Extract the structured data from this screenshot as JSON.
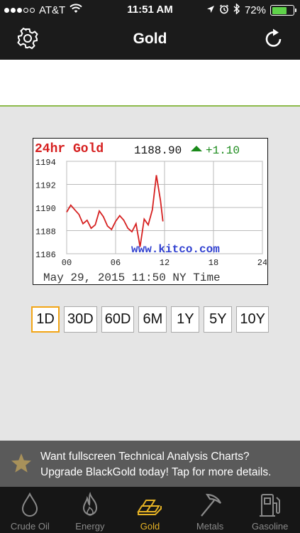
{
  "status_bar": {
    "carrier": "AT&T",
    "time": "11:51 AM",
    "battery_text": "72%",
    "battery_level": 0.72,
    "signal_bars_filled": 3,
    "signal_bars_total": 5
  },
  "nav": {
    "title": "Gold",
    "left_icon": "gear-icon",
    "right_icon": "refresh-icon"
  },
  "chart_image": {
    "title": "24hr Gold",
    "price": "1188.90",
    "change": "+1.10",
    "watermark": "www.kitco.com",
    "timestamp": "May 29, 2015 11:50 NY Time",
    "colors": {
      "title": "#d62020",
      "change": "#1a8a1a",
      "line": "#d62020",
      "watermark": "#3040d0"
    }
  },
  "chart_data": {
    "type": "line",
    "title": "24hr Gold",
    "xlabel": "",
    "ylabel": "",
    "xlim": [
      0,
      24
    ],
    "ylim": [
      1186,
      1194
    ],
    "x_ticks": [
      "00",
      "06",
      "12",
      "18",
      "24"
    ],
    "y_ticks": [
      "1186",
      "1188",
      "1190",
      "1192",
      "1194"
    ],
    "grid": true,
    "series": [
      {
        "x": [
          0,
          0.5,
          1,
          1.5,
          2,
          2.5,
          3,
          3.5,
          4,
          4.5,
          5,
          5.5,
          6,
          6.5,
          7,
          7.5,
          8,
          8.5,
          9,
          9.5,
          10,
          10.5,
          11,
          11.5,
          11.8
        ],
        "y": [
          1189.6,
          1190.2,
          1189.8,
          1189.4,
          1188.6,
          1188.9,
          1188.2,
          1188.5,
          1189.7,
          1189.2,
          1188.4,
          1188.1,
          1188.8,
          1189.3,
          1188.9,
          1188.2,
          1187.9,
          1188.6,
          1186.6,
          1189.0,
          1188.5,
          1189.8,
          1192.8,
          1190.6,
          1188.8
        ]
      }
    ]
  },
  "ranges": {
    "items": [
      "1D",
      "30D",
      "60D",
      "6M",
      "1Y",
      "5Y",
      "10Y"
    ],
    "selected": "1D"
  },
  "promo": {
    "line1": "Want fullscreen Technical Analysis Charts?",
    "line2": "Upgrade BlackGold today! Tap for more details.",
    "icon": "star-icon"
  },
  "tabs": [
    {
      "label": "Crude Oil",
      "icon": "oil-drop-icon",
      "active": false
    },
    {
      "label": "Energy",
      "icon": "flame-icon",
      "active": false
    },
    {
      "label": "Gold",
      "icon": "gold-bars-icon",
      "active": true
    },
    {
      "label": "Metals",
      "icon": "pickaxe-icon",
      "active": false
    },
    {
      "label": "Gasoline",
      "icon": "gas-pump-icon",
      "active": false
    }
  ]
}
